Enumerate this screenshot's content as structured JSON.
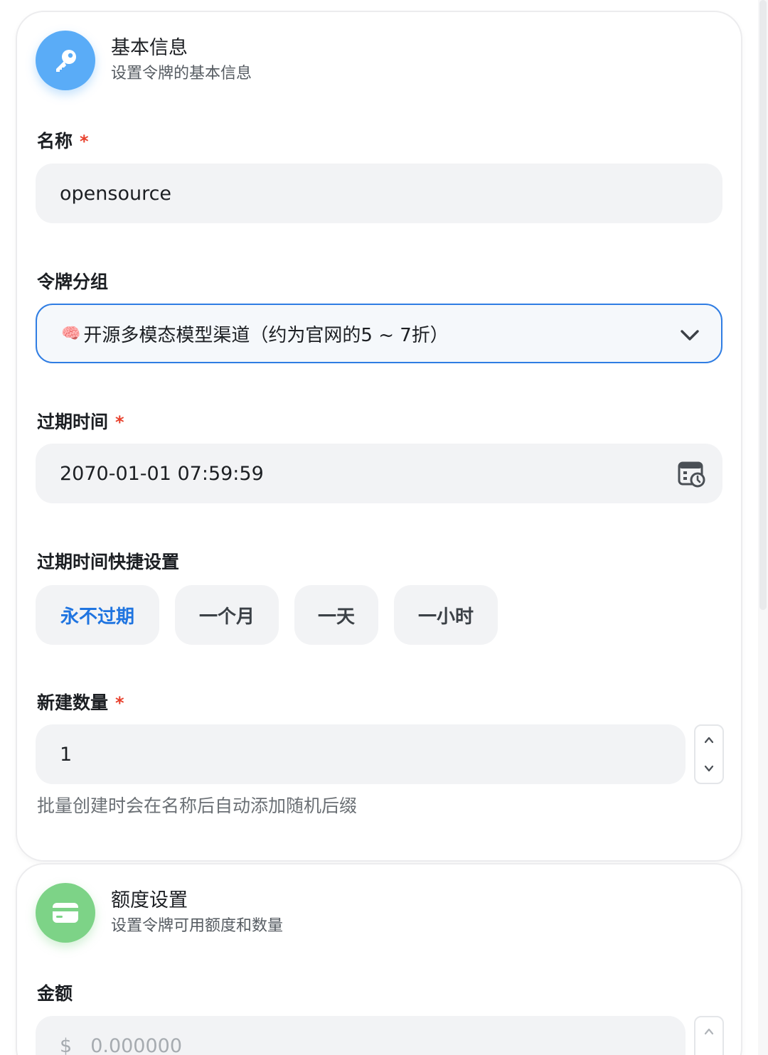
{
  "basic": {
    "title": "基本信息",
    "subtitle": "设置令牌的基本信息",
    "icon": "key-icon",
    "icon_color": "#5aacf7",
    "name_label": "名称",
    "required_mark": "*",
    "name_value": "opensource",
    "group_label": "令牌分组",
    "group_emoji": "🧠",
    "group_value": "开源多模态模型渠道（约为官网的5 ~ 7折）",
    "expire_label": "过期时间",
    "expire_value": "2070-01-01 07:59:59",
    "quick_label": "过期时间快捷设置",
    "quick_options": [
      "永不过期",
      "一个月",
      "一天",
      "一小时"
    ],
    "quick_selected": "永不过期",
    "count_label": "新建数量",
    "count_value": "1",
    "count_hint": "批量创建时会在名称后自动添加随机后缀"
  },
  "quota": {
    "title": "额度设置",
    "subtitle": "设置令牌可用额度和数量",
    "icon": "credit-card-icon",
    "icon_color": "#7dd387",
    "amount_label": "金额",
    "currency_prefix": "$",
    "amount_placeholder": "0.000000"
  },
  "colors": {
    "accent": "#2f7de3",
    "required": "#e8402c"
  }
}
